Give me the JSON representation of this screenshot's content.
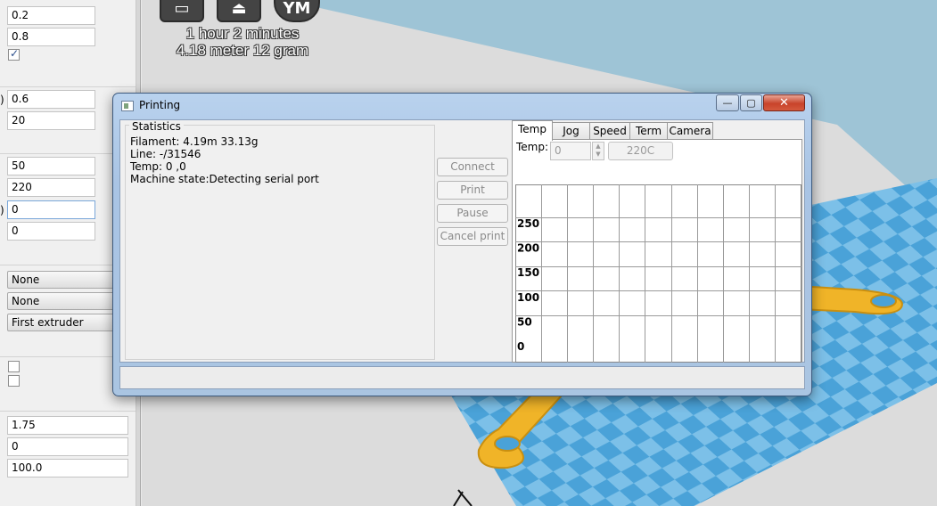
{
  "left_panel": {
    "inputs": [
      {
        "value": "0.2"
      },
      {
        "value": "0.8"
      },
      {
        "value": "0.6",
        "label_fragment": ")"
      },
      {
        "value": "20"
      },
      {
        "value": "50"
      },
      {
        "value": "220"
      },
      {
        "value": "0",
        "label_fragment": ")"
      },
      {
        "value": "0"
      },
      {
        "value": "1.75"
      },
      {
        "value": "0"
      },
      {
        "value": "100.0"
      }
    ],
    "selects": [
      {
        "value": "None"
      },
      {
        "value": "None"
      },
      {
        "value": "First extruder"
      }
    ],
    "checkboxes": [
      {
        "checked": true
      },
      {
        "checked": false
      },
      {
        "checked": false
      }
    ]
  },
  "viewport": {
    "print_time": "1 hour 2 minutes",
    "print_material": "4.18 meter 12 gram",
    "toolbar_buttons": [
      {
        "icon": "printer-load-icon"
      },
      {
        "icon": "sd-card-save-icon"
      },
      {
        "icon": "youmagine-share-icon",
        "label": "YM"
      }
    ],
    "colors": {
      "background": "#dcdcdc",
      "sky": "#9ec4d6",
      "bed_light": "#7cc0e8",
      "bed_dark": "#4aa2d8",
      "model": "#f0b428"
    }
  },
  "dialog": {
    "title": "Printing",
    "window_buttons": {
      "minimize": "—",
      "maximize": "▢",
      "close": "✕"
    },
    "statistics": {
      "legend": "Statistics",
      "lines": [
        "Filament: 4.19m 33.13g",
        "Line: -/31546",
        "Temp: 0 ,0",
        "Machine state:Detecting serial port"
      ]
    },
    "actions": {
      "connect": "Connect",
      "print": "Print",
      "pause": "Pause",
      "cancel": "Cancel print"
    },
    "tabs": [
      "Temp",
      "Jog",
      "Speed",
      "Term",
      "Camera"
    ],
    "active_tab": "Temp",
    "temp_panel": {
      "label": "Temp:",
      "value": "0",
      "set_button": "220C"
    }
  },
  "chart_data": {
    "type": "line",
    "title": "",
    "xlabel": "",
    "ylabel": "",
    "y_ticks": [
      "250",
      "200",
      "150",
      "100",
      "50",
      "0"
    ],
    "ylim": [
      0,
      250
    ],
    "grid": true,
    "series": []
  }
}
